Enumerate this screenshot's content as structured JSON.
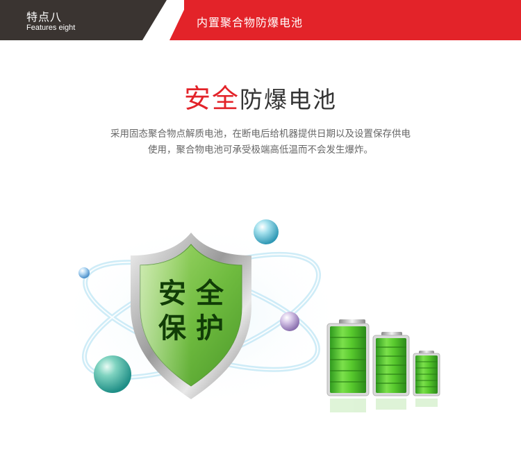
{
  "banner": {
    "feature_cn": "特点八",
    "feature_en": "Features eight",
    "title": "内置聚合物防爆电池"
  },
  "headline": {
    "red": "安全",
    "dark": "防爆电池"
  },
  "description": {
    "line1": "采用固态聚合物点解质电池，在断电后给机器提供日期以及设置保存供电",
    "line2": "使用，聚合物电池可承受极端高低温而不会发生爆炸。"
  },
  "shield": {
    "line1": "安 全",
    "line2": "保 护"
  },
  "batteries": [
    {
      "level": 1.0
    },
    {
      "level": 1.0
    },
    {
      "level": 1.0
    }
  ],
  "colors": {
    "banner_dark": "#3a3431",
    "banner_red": "#e32329",
    "headline_red": "#e32329",
    "shield_green": "#7cc44a",
    "battery_green": "#4fc228"
  }
}
